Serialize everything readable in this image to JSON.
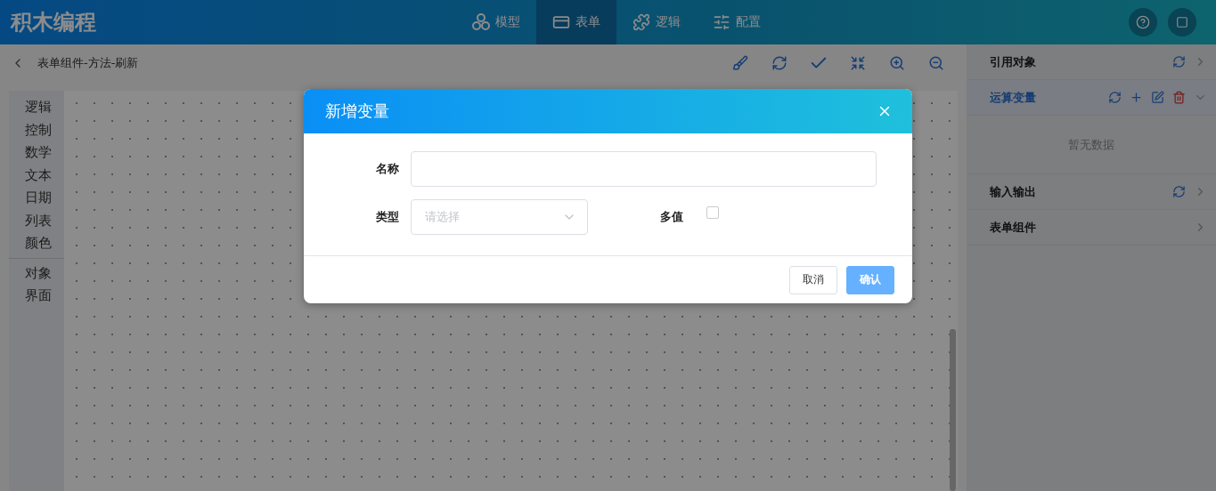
{
  "app": {
    "title": "积木编程"
  },
  "nav_tabs": [
    {
      "label": "模型",
      "selected": false
    },
    {
      "label": "表单",
      "selected": true
    },
    {
      "label": "逻辑",
      "selected": false
    },
    {
      "label": "配置",
      "selected": false
    }
  ],
  "breadcrumb": "表单组件-方法-刷新",
  "palette": {
    "groups": [
      [
        "逻辑",
        "控制",
        "数学",
        "文本",
        "日期",
        "列表",
        "颜色"
      ],
      [
        "对象",
        "界面"
      ]
    ]
  },
  "right_panel": {
    "sections": [
      {
        "title": "引用对象",
        "active": false,
        "expanded": false
      },
      {
        "title": "运算变量",
        "active": true,
        "expanded": true,
        "empty_text": "暂无数据"
      },
      {
        "title": "输入输出",
        "active": false,
        "expanded": false
      },
      {
        "title": "表单组件",
        "active": false,
        "expanded": false
      }
    ]
  },
  "dialog": {
    "title": "新增变量",
    "name_field": {
      "label": "名称"
    },
    "type_field": {
      "label": "类型",
      "placeholder": "请选择"
    },
    "multi_field": {
      "label": "多值",
      "checked": false
    },
    "buttons": [
      {
        "label": "取消",
        "kind": "default",
        "disabled": false
      },
      {
        "label": "确认",
        "kind": "primary",
        "disabled": true
      }
    ]
  }
}
